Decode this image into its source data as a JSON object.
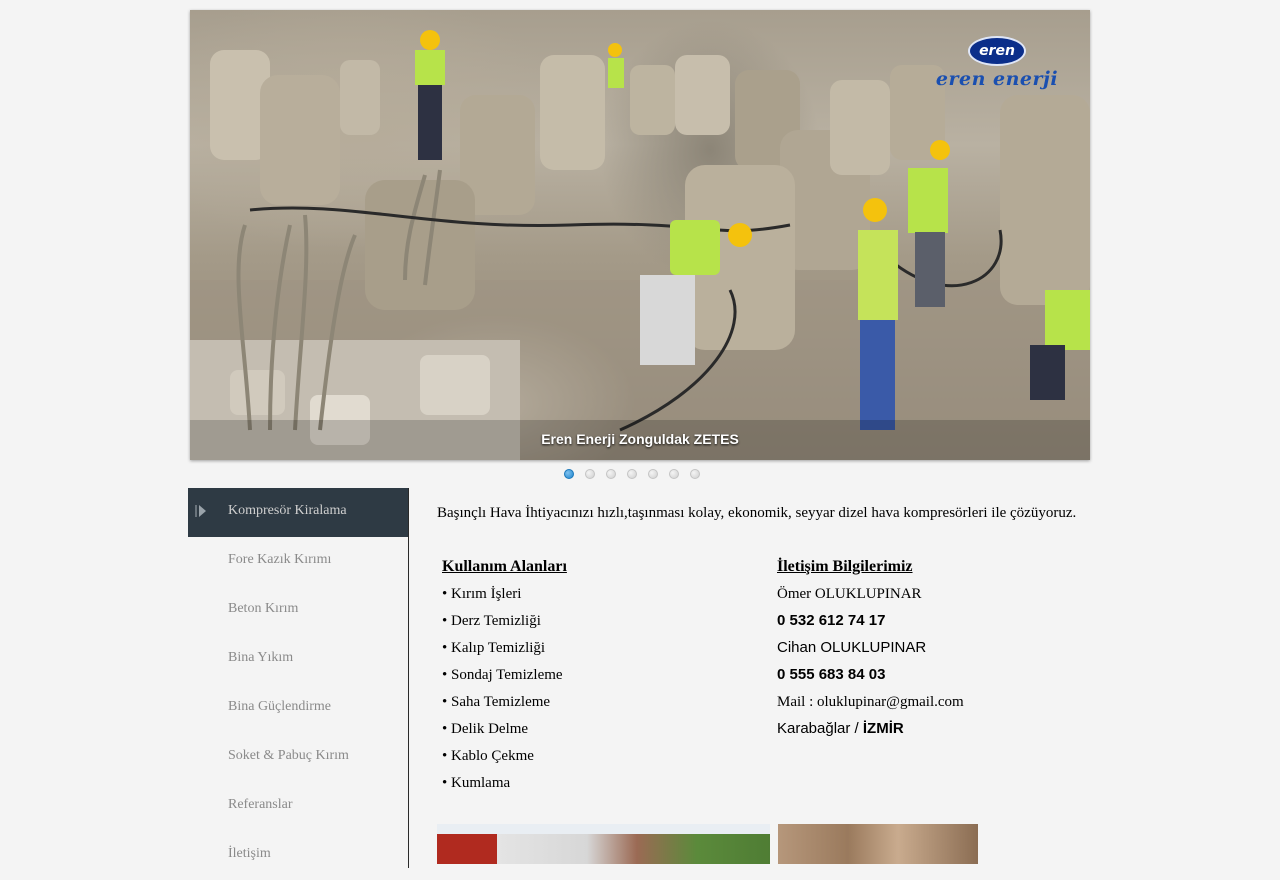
{
  "slider": {
    "logo_badge": "eren",
    "logo_text": "eren enerji",
    "caption": "Eren Enerji Zonguldak ZETES",
    "slide_count": 7,
    "active_slide": 1
  },
  "sidebar": {
    "items": [
      {
        "label": "Kompresör Kiralama",
        "active": true
      },
      {
        "label": "Fore Kazık Kırımı"
      },
      {
        "label": "Beton Kırım"
      },
      {
        "label": "Bina Yıkım"
      },
      {
        "label": "Bina Güçlendirme"
      },
      {
        "label": "Soket & Pabuç Kırım"
      },
      {
        "label": "Referanslar"
      },
      {
        "label": "İletişim"
      }
    ]
  },
  "content": {
    "intro": "Başınçlı Hava İhtiyacınızı hızlı,taşınması kolay, ekonomik, seyyar dizel hava kompresörleri ile çözüyoruz.",
    "usage": {
      "heading": "Kullanım Alanları",
      "items": [
        "• Kırım İşleri",
        "• Derz Temizliği",
        "• Kalıp Temizliği",
        "• Sondaj Temizleme",
        "• Saha Temizleme",
        "• Delik Delme",
        "• Kablo Çekme",
        "• Kumlama"
      ]
    },
    "contact": {
      "heading": "İletişim Bilgilerimiz",
      "name1": "Ömer OLUKLUPINAR",
      "phone1": "0 532 612 74 17",
      "name2": "Cihan OLUKLUPINAR",
      "phone2": "0 555 683 84 03",
      "mail": "Mail : oluklupinar@gmail.com",
      "district": "Karabağlar / ",
      "city": "İZMİR"
    }
  }
}
